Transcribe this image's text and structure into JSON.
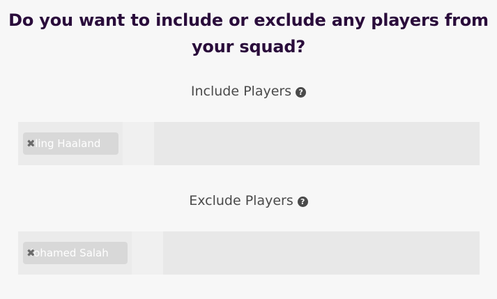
{
  "question": {
    "line1": "Do you want to include or exclude any players from",
    "line2": "your squad?"
  },
  "include": {
    "label": "Include Players",
    "help_icon": "question-circle-icon",
    "chips": [
      {
        "visible_text": "rling Haaland",
        "remove_icon": "close-x-icon"
      }
    ]
  },
  "exclude": {
    "label": "Exclude Players",
    "help_icon": "question-circle-icon",
    "chips": [
      {
        "visible_text": "lohamed Salah",
        "remove_icon": "close-x-icon"
      }
    ]
  },
  "colors": {
    "heading": "#2a0c3b",
    "field_bg": "#e8e8e8",
    "chip_bg": "#d8d8d8"
  }
}
